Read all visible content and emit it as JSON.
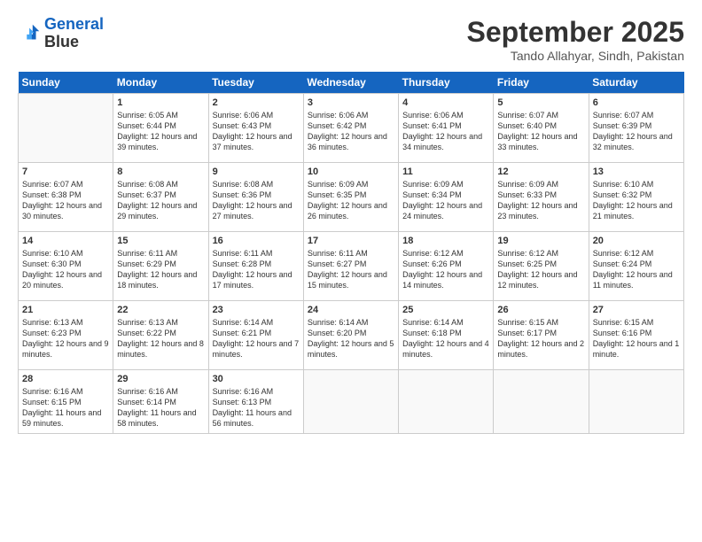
{
  "logo": {
    "line1": "General",
    "line2": "Blue"
  },
  "title": "September 2025",
  "location": "Tando Allahyar, Sindh, Pakistan",
  "days_header": [
    "Sunday",
    "Monday",
    "Tuesday",
    "Wednesday",
    "Thursday",
    "Friday",
    "Saturday"
  ],
  "weeks": [
    [
      {
        "num": "",
        "sunrise": "",
        "sunset": "",
        "daylight": ""
      },
      {
        "num": "1",
        "sunrise": "Sunrise: 6:05 AM",
        "sunset": "Sunset: 6:44 PM",
        "daylight": "Daylight: 12 hours and 39 minutes."
      },
      {
        "num": "2",
        "sunrise": "Sunrise: 6:06 AM",
        "sunset": "Sunset: 6:43 PM",
        "daylight": "Daylight: 12 hours and 37 minutes."
      },
      {
        "num": "3",
        "sunrise": "Sunrise: 6:06 AM",
        "sunset": "Sunset: 6:42 PM",
        "daylight": "Daylight: 12 hours and 36 minutes."
      },
      {
        "num": "4",
        "sunrise": "Sunrise: 6:06 AM",
        "sunset": "Sunset: 6:41 PM",
        "daylight": "Daylight: 12 hours and 34 minutes."
      },
      {
        "num": "5",
        "sunrise": "Sunrise: 6:07 AM",
        "sunset": "Sunset: 6:40 PM",
        "daylight": "Daylight: 12 hours and 33 minutes."
      },
      {
        "num": "6",
        "sunrise": "Sunrise: 6:07 AM",
        "sunset": "Sunset: 6:39 PM",
        "daylight": "Daylight: 12 hours and 32 minutes."
      }
    ],
    [
      {
        "num": "7",
        "sunrise": "Sunrise: 6:07 AM",
        "sunset": "Sunset: 6:38 PM",
        "daylight": "Daylight: 12 hours and 30 minutes."
      },
      {
        "num": "8",
        "sunrise": "Sunrise: 6:08 AM",
        "sunset": "Sunset: 6:37 PM",
        "daylight": "Daylight: 12 hours and 29 minutes."
      },
      {
        "num": "9",
        "sunrise": "Sunrise: 6:08 AM",
        "sunset": "Sunset: 6:36 PM",
        "daylight": "Daylight: 12 hours and 27 minutes."
      },
      {
        "num": "10",
        "sunrise": "Sunrise: 6:09 AM",
        "sunset": "Sunset: 6:35 PM",
        "daylight": "Daylight: 12 hours and 26 minutes."
      },
      {
        "num": "11",
        "sunrise": "Sunrise: 6:09 AM",
        "sunset": "Sunset: 6:34 PM",
        "daylight": "Daylight: 12 hours and 24 minutes."
      },
      {
        "num": "12",
        "sunrise": "Sunrise: 6:09 AM",
        "sunset": "Sunset: 6:33 PM",
        "daylight": "Daylight: 12 hours and 23 minutes."
      },
      {
        "num": "13",
        "sunrise": "Sunrise: 6:10 AM",
        "sunset": "Sunset: 6:32 PM",
        "daylight": "Daylight: 12 hours and 21 minutes."
      }
    ],
    [
      {
        "num": "14",
        "sunrise": "Sunrise: 6:10 AM",
        "sunset": "Sunset: 6:30 PM",
        "daylight": "Daylight: 12 hours and 20 minutes."
      },
      {
        "num": "15",
        "sunrise": "Sunrise: 6:11 AM",
        "sunset": "Sunset: 6:29 PM",
        "daylight": "Daylight: 12 hours and 18 minutes."
      },
      {
        "num": "16",
        "sunrise": "Sunrise: 6:11 AM",
        "sunset": "Sunset: 6:28 PM",
        "daylight": "Daylight: 12 hours and 17 minutes."
      },
      {
        "num": "17",
        "sunrise": "Sunrise: 6:11 AM",
        "sunset": "Sunset: 6:27 PM",
        "daylight": "Daylight: 12 hours and 15 minutes."
      },
      {
        "num": "18",
        "sunrise": "Sunrise: 6:12 AM",
        "sunset": "Sunset: 6:26 PM",
        "daylight": "Daylight: 12 hours and 14 minutes."
      },
      {
        "num": "19",
        "sunrise": "Sunrise: 6:12 AM",
        "sunset": "Sunset: 6:25 PM",
        "daylight": "Daylight: 12 hours and 12 minutes."
      },
      {
        "num": "20",
        "sunrise": "Sunrise: 6:12 AM",
        "sunset": "Sunset: 6:24 PM",
        "daylight": "Daylight: 12 hours and 11 minutes."
      }
    ],
    [
      {
        "num": "21",
        "sunrise": "Sunrise: 6:13 AM",
        "sunset": "Sunset: 6:23 PM",
        "daylight": "Daylight: 12 hours and 9 minutes."
      },
      {
        "num": "22",
        "sunrise": "Sunrise: 6:13 AM",
        "sunset": "Sunset: 6:22 PM",
        "daylight": "Daylight: 12 hours and 8 minutes."
      },
      {
        "num": "23",
        "sunrise": "Sunrise: 6:14 AM",
        "sunset": "Sunset: 6:21 PM",
        "daylight": "Daylight: 12 hours and 7 minutes."
      },
      {
        "num": "24",
        "sunrise": "Sunrise: 6:14 AM",
        "sunset": "Sunset: 6:20 PM",
        "daylight": "Daylight: 12 hours and 5 minutes."
      },
      {
        "num": "25",
        "sunrise": "Sunrise: 6:14 AM",
        "sunset": "Sunset: 6:18 PM",
        "daylight": "Daylight: 12 hours and 4 minutes."
      },
      {
        "num": "26",
        "sunrise": "Sunrise: 6:15 AM",
        "sunset": "Sunset: 6:17 PM",
        "daylight": "Daylight: 12 hours and 2 minutes."
      },
      {
        "num": "27",
        "sunrise": "Sunrise: 6:15 AM",
        "sunset": "Sunset: 6:16 PM",
        "daylight": "Daylight: 12 hours and 1 minute."
      }
    ],
    [
      {
        "num": "28",
        "sunrise": "Sunrise: 6:16 AM",
        "sunset": "Sunset: 6:15 PM",
        "daylight": "Daylight: 11 hours and 59 minutes."
      },
      {
        "num": "29",
        "sunrise": "Sunrise: 6:16 AM",
        "sunset": "Sunset: 6:14 PM",
        "daylight": "Daylight: 11 hours and 58 minutes."
      },
      {
        "num": "30",
        "sunrise": "Sunrise: 6:16 AM",
        "sunset": "Sunset: 6:13 PM",
        "daylight": "Daylight: 11 hours and 56 minutes."
      },
      {
        "num": "",
        "sunrise": "",
        "sunset": "",
        "daylight": ""
      },
      {
        "num": "",
        "sunrise": "",
        "sunset": "",
        "daylight": ""
      },
      {
        "num": "",
        "sunrise": "",
        "sunset": "",
        "daylight": ""
      },
      {
        "num": "",
        "sunrise": "",
        "sunset": "",
        "daylight": ""
      }
    ]
  ]
}
